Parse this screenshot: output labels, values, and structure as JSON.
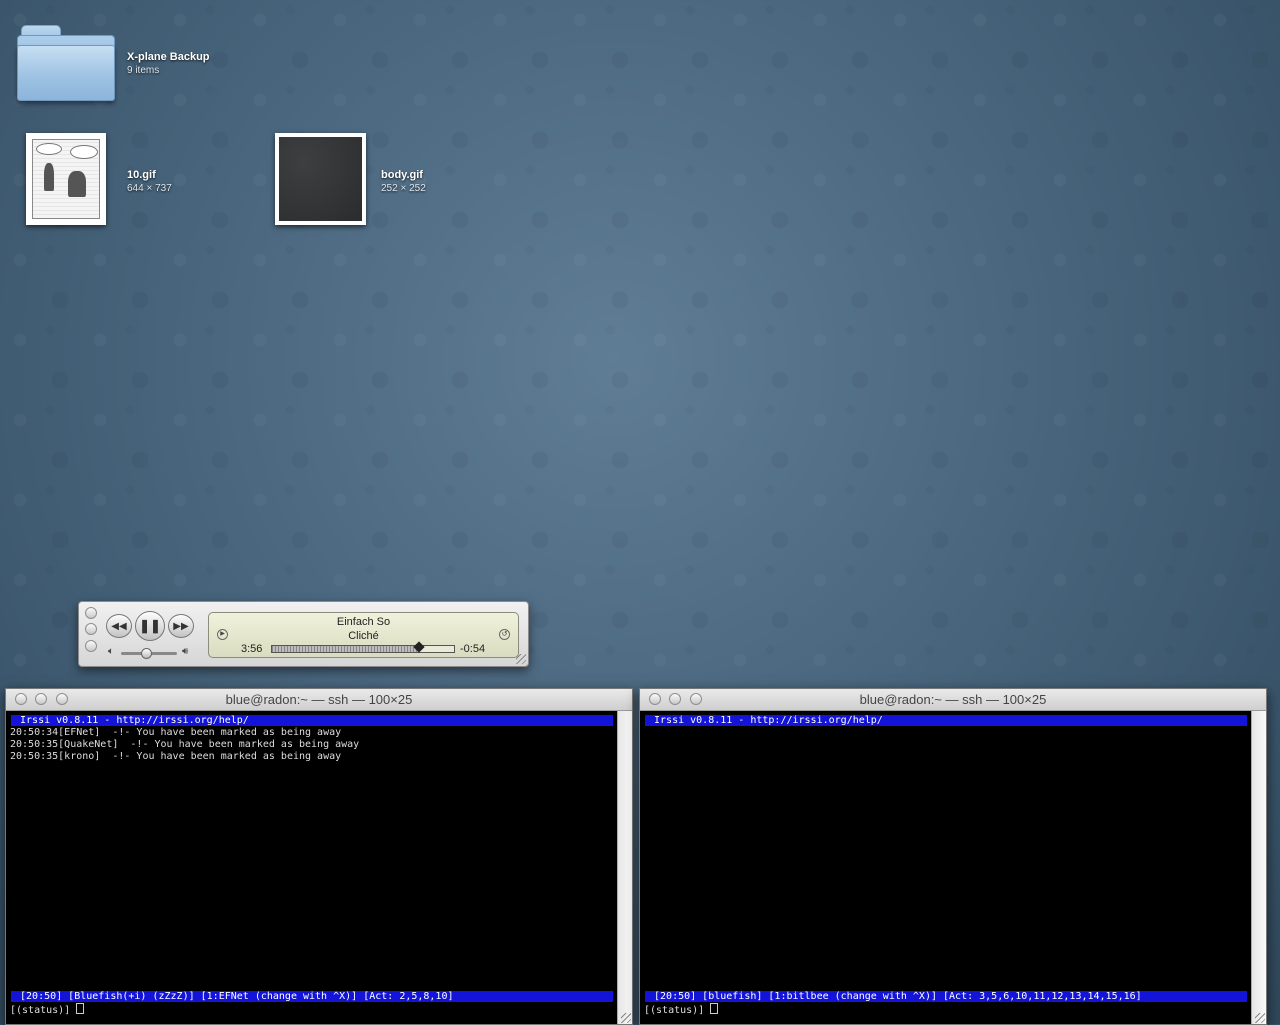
{
  "desktop": {
    "folder": {
      "name": "X-plane Backup",
      "info": "9 items"
    },
    "files": [
      {
        "name": "10.gif",
        "dims": "644 × 737"
      },
      {
        "name": "body.gif",
        "dims": "252 × 252"
      }
    ]
  },
  "itunes": {
    "song": "Einfach So",
    "artist": "Cliché",
    "elapsed": "3:56",
    "remaining": "-0:54",
    "progress": 0.81,
    "volume": 0.45
  },
  "terminals": [
    {
      "title": "blue@radon:~ — ssh — 100×25",
      "header_bar": " Irssi v0.8.11 - http://irssi.org/help/",
      "lines": [
        "20:50:34[EFNet]  -!- You have been marked as being away",
        "20:50:35[QuakeNet]  -!- You have been marked as being away",
        "20:50:35[krono]  -!- You have been marked as being away"
      ],
      "status_bar": " [20:50] [Bluefish(+i) (zZzZ)] [1:EFNet (change with ^X)] [Act: 2,5,8,10]",
      "prompt": "[(status)] "
    },
    {
      "title": "blue@radon:~ — ssh — 100×25",
      "header_bar": " Irssi v0.8.11 - http://irssi.org/help/",
      "lines": [],
      "status_bar": " [20:50] [bluefish] [1:bitlbee (change with ^X)] [Act: 3,5,6,10,11,12,13,14,15,16]",
      "prompt": "[(status)] "
    }
  ]
}
